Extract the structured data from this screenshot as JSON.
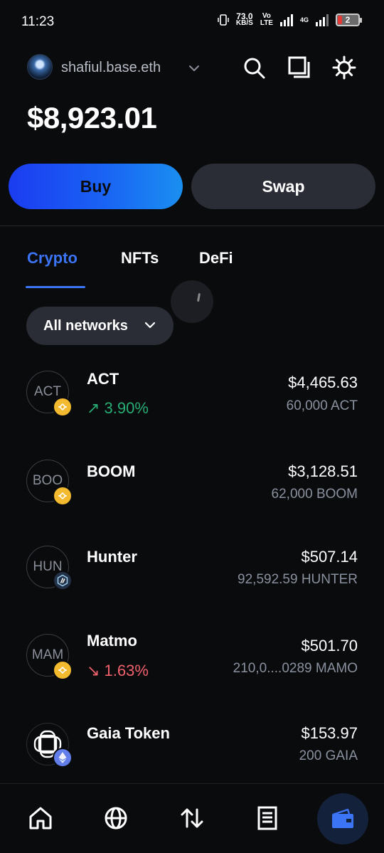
{
  "status_bar": {
    "time": "11:23",
    "net_speed_value": "73.0",
    "net_speed_unit": "KB/S",
    "volte_top": "Vo",
    "volte_bottom": "LTE",
    "network_type": "4G",
    "battery_level": "2"
  },
  "header": {
    "account_name": "shafiul.base.eth",
    "icons": [
      "search-icon",
      "copy-icon",
      "gear-icon"
    ]
  },
  "balance": "$8,923.01",
  "actions": {
    "buy_label": "Buy",
    "swap_label": "Swap"
  },
  "tabs": [
    {
      "label": "Crypto",
      "active": true
    },
    {
      "label": "NFTs",
      "active": false
    },
    {
      "label": "DeFi",
      "active": false
    }
  ],
  "filter": {
    "label": "All networks"
  },
  "assets": [
    {
      "icon_text": "ACT",
      "name": "ACT",
      "change": "↗ 3.90%",
      "change_dir": "up",
      "value": "$4,465.63",
      "amount": "60,000 ACT",
      "network": "bnb-icon"
    },
    {
      "icon_text": "BOO",
      "name": "BOOM",
      "change": "",
      "change_dir": "",
      "value": "$3,128.51",
      "amount": "62,000 BOOM",
      "network": "bnb-icon"
    },
    {
      "icon_text": "HUN",
      "name": "Hunter",
      "change": "",
      "change_dir": "",
      "value": "$507.14",
      "amount": "92,592.59 HUNTER",
      "network": "arbitrum-icon"
    },
    {
      "icon_text": "MAM",
      "name": "Matmo",
      "change": "↘ 1.63%",
      "change_dir": "down",
      "value": "$501.70",
      "amount": "210,0....0289 MAMO",
      "network": "bnb-icon"
    },
    {
      "icon_text": "",
      "name": "Gaia Token",
      "change": "",
      "change_dir": "",
      "value": "$153.97",
      "amount": "200 GAIA",
      "network": "ethereum-icon"
    }
  ],
  "bottom_nav": [
    "home-icon",
    "globe-icon",
    "transfer-icon",
    "activity-icon",
    "wallet-icon"
  ],
  "colors": {
    "accent": "#3b74f4",
    "positive": "#27ad75",
    "negative": "#f0616d",
    "background": "#0a0b0d"
  }
}
